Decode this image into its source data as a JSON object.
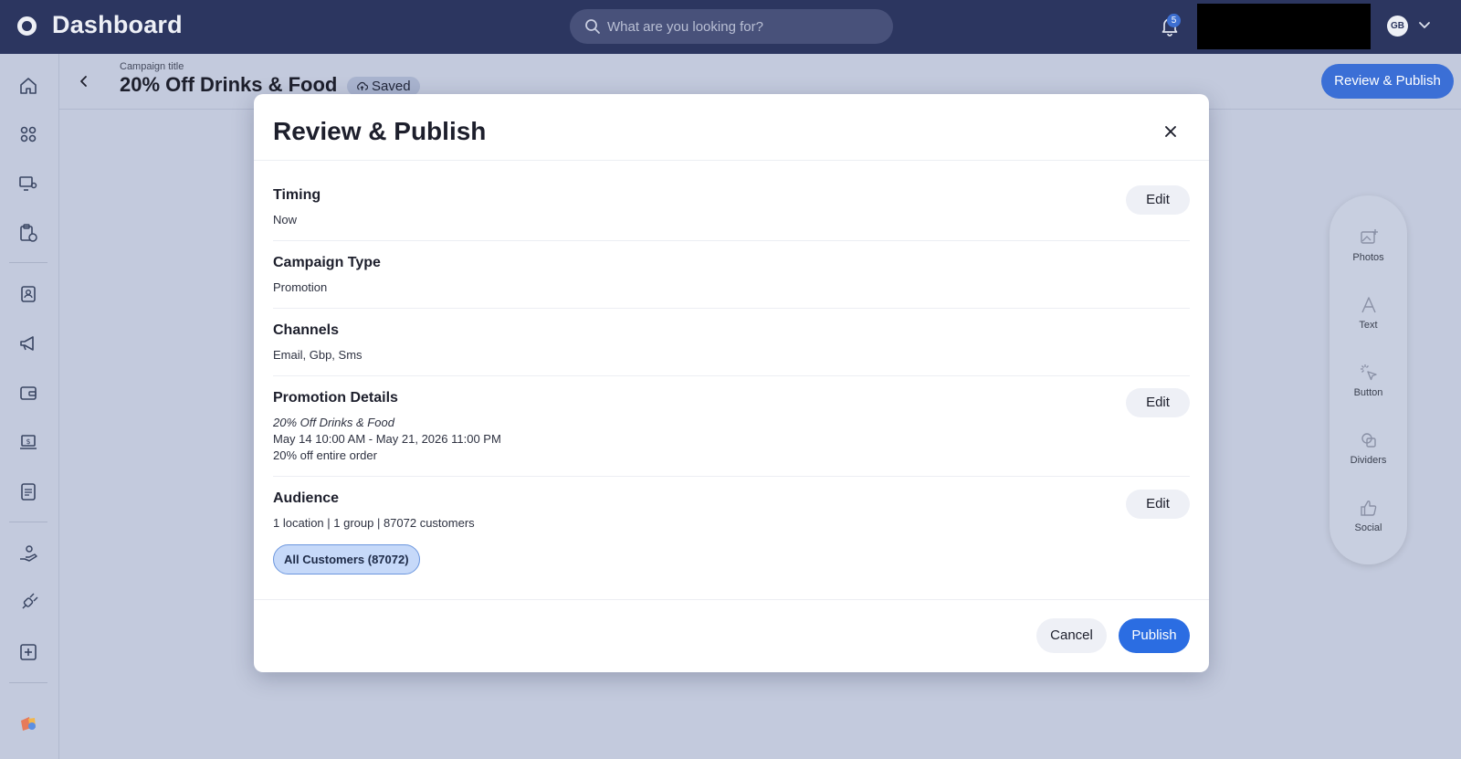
{
  "app": {
    "title": "Dashboard"
  },
  "search": {
    "placeholder": "What are you looking for?"
  },
  "notifications": {
    "count": "5"
  },
  "user": {
    "initials": "GB"
  },
  "campaign": {
    "title_label": "Campaign title",
    "title": "20% Off Drinks & Food",
    "status": "Saved"
  },
  "header": {
    "review_publish_label": "Review & Publish"
  },
  "toolbox": {
    "items": [
      {
        "label": "Photos",
        "icon": "photo-add-icon"
      },
      {
        "label": "Text",
        "icon": "text-icon"
      },
      {
        "label": "Button",
        "icon": "cursor-click-icon"
      },
      {
        "label": "Dividers",
        "icon": "dividers-icon"
      },
      {
        "label": "Social",
        "icon": "thumbs-up-icon"
      }
    ]
  },
  "sidebar": {
    "icons": [
      "home-icon",
      "apps-icon",
      "monitor-settings-icon",
      "clipboard-clock-icon",
      "contacts-icon",
      "megaphone-icon",
      "wallet-icon",
      "laptop-dollar-icon",
      "document-icon",
      "hand-person-icon",
      "plug-icon",
      "plus-square-icon",
      "brand-logo-icon"
    ]
  },
  "modal": {
    "title": "Review & Publish",
    "edit_label": "Edit",
    "timing": {
      "title": "Timing",
      "value": "Now"
    },
    "campaign_type": {
      "title": "Campaign Type",
      "value": "Promotion"
    },
    "channels": {
      "title": "Channels",
      "value": "Email, Gbp, Sms"
    },
    "promotion": {
      "title": "Promotion Details",
      "name": "20% Off Drinks & Food",
      "dates": "May 14 10:00 AM - May 21, 2026 11:00 PM",
      "offer": "20% off entire order"
    },
    "audience": {
      "title": "Audience",
      "summary": "1 location | 1 group | 87072 customers",
      "chip": "All Customers (87072)"
    },
    "cancel_label": "Cancel",
    "publish_label": "Publish"
  },
  "colors": {
    "topbar": "#2c3660",
    "background": "#c3cadd",
    "primary": "#2b6de2",
    "chip_bg": "#c6d9f9"
  }
}
